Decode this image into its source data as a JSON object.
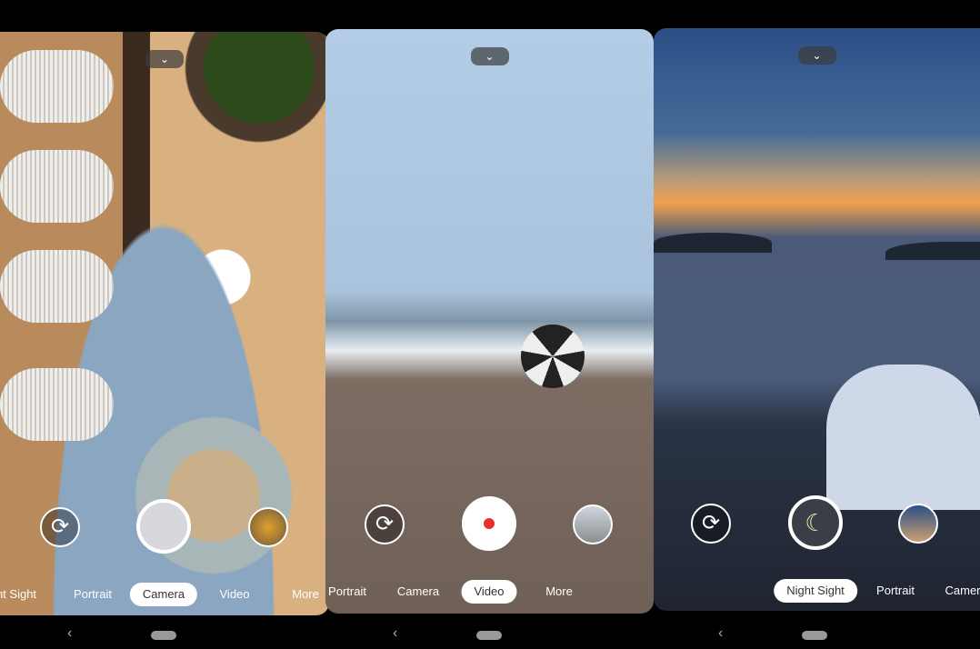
{
  "screens": [
    {
      "modes": [
        "ht Sight",
        "Portrait",
        "Camera",
        "Video",
        "More"
      ],
      "selected": "Camera",
      "shutter": "photo-shutter",
      "thumb_color": "#6a5a3a"
    },
    {
      "modes": [
        "Portrait",
        "Camera",
        "Video",
        "More"
      ],
      "selected": "Video",
      "shutter": "record-button",
      "record_color": "#e8312a",
      "thumb_color": "#aab3ba"
    },
    {
      "modes": [
        "Night Sight",
        "Portrait",
        "Camer"
      ],
      "selected": "Night Sight",
      "shutter": "night-sight-shutter",
      "moon_color": "#f3e6a8",
      "thumb_color": "#2b4f86"
    }
  ],
  "icons": {
    "chevron": "chevron-down-icon",
    "flip": "camera-flip-icon",
    "back": "back-icon",
    "home": "home-pill"
  },
  "glyphs": {
    "chevron": "⌄",
    "flip": "⟳",
    "back": "‹",
    "moon": "☾"
  }
}
